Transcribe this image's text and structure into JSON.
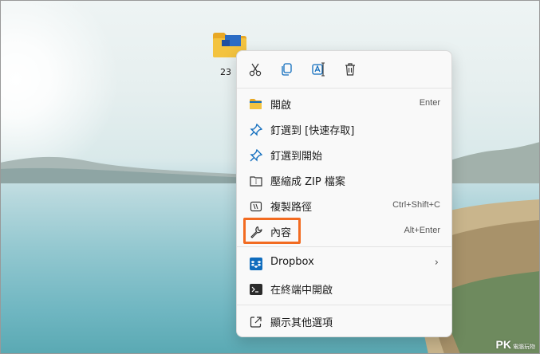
{
  "desktop": {
    "icon_label": "23",
    "watermark_main": "PK",
    "watermark_sub": "電腦玩物"
  },
  "quick_actions": [
    {
      "name": "cut",
      "icon": "scissors-icon"
    },
    {
      "name": "copy",
      "icon": "copy-icon"
    },
    {
      "name": "rename",
      "icon": "rename-icon"
    },
    {
      "name": "delete",
      "icon": "trash-icon"
    }
  ],
  "menu": {
    "items": [
      {
        "label": "開啟",
        "shortcut": "Enter",
        "icon": "folder-icon"
      },
      {
        "label": "釘選到 [快速存取]",
        "shortcut": "",
        "icon": "pin-icon"
      },
      {
        "label": "釘選到開始",
        "shortcut": "",
        "icon": "pin-icon"
      },
      {
        "label": "壓縮成 ZIP 檔案",
        "shortcut": "",
        "icon": "zip-icon"
      },
      {
        "label": "複製路徑",
        "shortcut": "Ctrl+Shift+C",
        "icon": "copy-path-icon"
      },
      {
        "label": "內容",
        "shortcut": "Alt+Enter",
        "icon": "wrench-icon"
      },
      {
        "label": "Dropbox",
        "shortcut": "",
        "icon": "dropbox-icon",
        "submenu": true
      },
      {
        "label": "在終端中開啟",
        "shortcut": "",
        "icon": "terminal-icon"
      },
      {
        "label": "顯示其他選項",
        "shortcut": "",
        "icon": "more-options-icon"
      }
    ]
  },
  "colors": {
    "accent": "#0f6cbd",
    "highlight": "#f26b21",
    "folder": "#f3c33f"
  }
}
